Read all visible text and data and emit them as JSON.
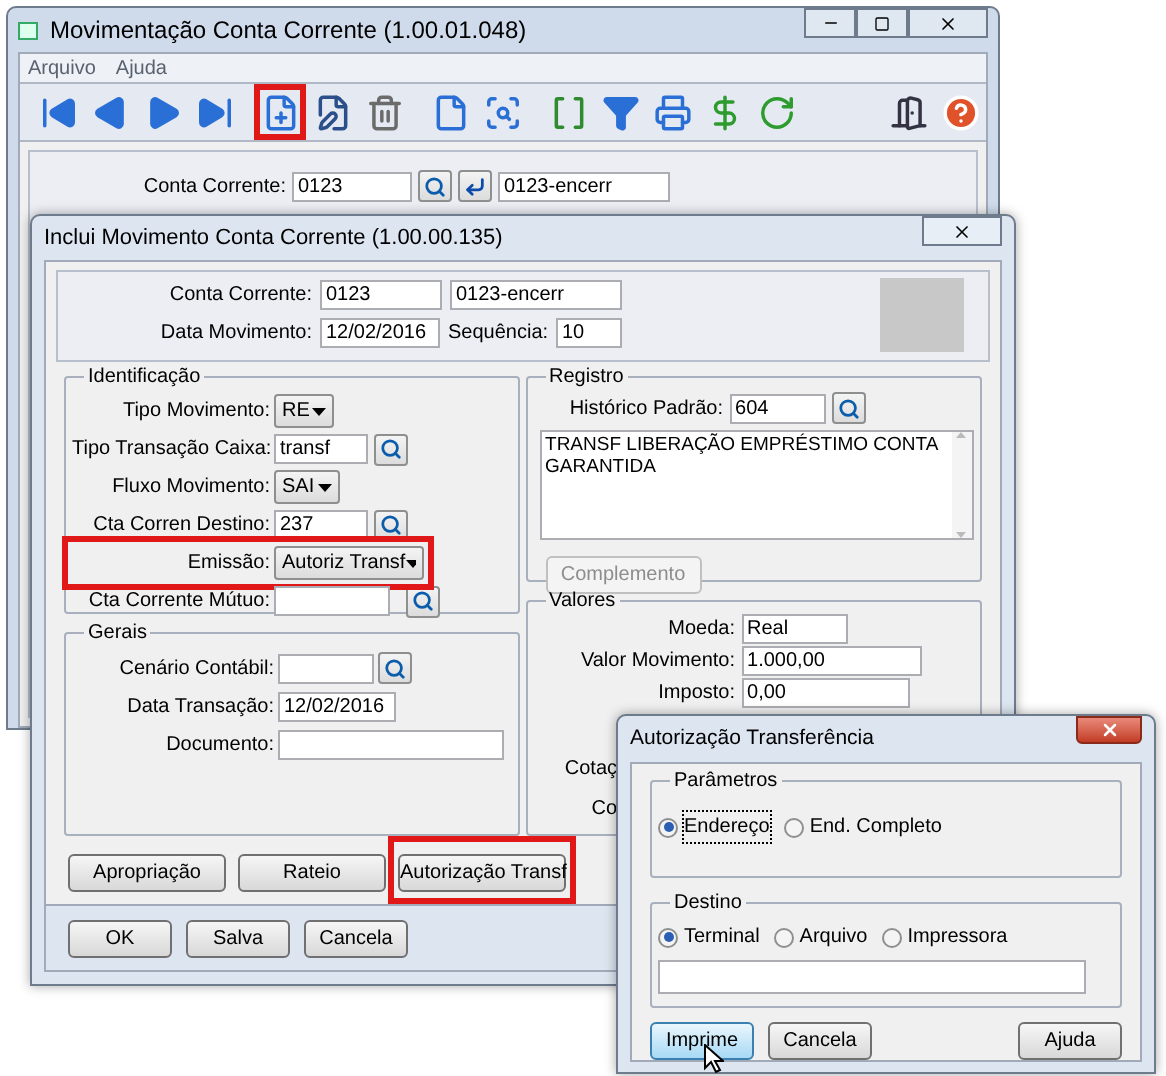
{
  "main_window": {
    "title": "Movimentação Conta Corrente (1.00.01.048)",
    "menu": [
      "Arquivo",
      "Ajuda"
    ],
    "toolbar": [
      {
        "kind": "first",
        "highlighted": false
      },
      {
        "kind": "previous",
        "highlighted": false
      },
      {
        "kind": "next",
        "highlighted": false
      },
      {
        "kind": "last",
        "highlighted": false
      },
      {
        "kind": "new",
        "highlighted": true
      },
      {
        "kind": "edit",
        "highlighted": false
      },
      {
        "kind": "delete",
        "highlighted": false
      },
      {
        "kind": "document",
        "highlighted": false
      },
      {
        "kind": "preview",
        "highlighted": false
      },
      {
        "kind": "goto",
        "highlighted": false
      },
      {
        "kind": "filter",
        "highlighted": false
      },
      {
        "kind": "print",
        "highlighted": false
      },
      {
        "kind": "money",
        "highlighted": false
      },
      {
        "kind": "refresh",
        "highlighted": false
      },
      {
        "kind": "exit",
        "highlighted": false
      },
      {
        "kind": "help",
        "highlighted": false
      }
    ],
    "conta_corrente": {
      "label": "Conta Corrente:",
      "value": "0123",
      "description": "0123-encerr"
    }
  },
  "include_dialog": {
    "title": "Inclui Movimento Conta Corrente (1.00.00.135)",
    "conta_corrente": {
      "label": "Conta Corrente:",
      "value": "0123",
      "description": "0123-encerr"
    },
    "data_movimento": {
      "label": "Data Movimento:",
      "value": "12/02/2016"
    },
    "sequencia": {
      "label": "Sequência:",
      "value": "10"
    },
    "identificacao": {
      "title": "Identificação",
      "rows": [
        {
          "kind": "dropdown",
          "label": "Tipo Movimento:",
          "value": "RE",
          "highlighted": false
        },
        {
          "kind": "lookup",
          "label": "Tipo Transação Caixa:",
          "value": "transf",
          "highlighted": false
        },
        {
          "kind": "dropdown",
          "label": "Fluxo Movimento:",
          "value": "SAI",
          "highlighted": false
        },
        {
          "kind": "lookup",
          "label": "Cta Corren Destino:",
          "value": "237",
          "highlighted": false
        },
        {
          "kind": "dropdown",
          "label": "Emissão:",
          "value": "Autoriz Transf",
          "highlighted": true
        },
        {
          "kind": "lookup",
          "label": "Cta Corrente Mútuo:",
          "value": "",
          "highlighted": false
        }
      ]
    },
    "gerais": {
      "title": "Gerais",
      "rows": [
        {
          "kind": "lookup",
          "label": "Cenário Contábil:",
          "value": ""
        },
        {
          "kind": "text",
          "label": "Data Transação:",
          "value": "12/02/2016"
        },
        {
          "kind": "text",
          "label": "Documento:",
          "value": ""
        }
      ]
    },
    "registro": {
      "title": "Registro",
      "historico": {
        "label": "Histórico Padrão:",
        "value": "604"
      },
      "text": "TRANSF LIBERAÇÃO EMPRÉSTIMO CONTA GARANTIDA",
      "complemento": {
        "label": "Complemento",
        "disabled": true
      }
    },
    "valores": {
      "title": "Valores",
      "rows": [
        {
          "kind": "text",
          "label": "Moeda:",
          "value": "Real"
        },
        {
          "kind": "text",
          "label": "Valor Movimento:",
          "value": "1.000,00"
        },
        {
          "kind": "text",
          "label": "Imposto:",
          "value": "0,00"
        },
        {
          "kind": "cut",
          "label": "Cotaç"
        },
        {
          "kind": "cut",
          "label": "Co"
        }
      ]
    },
    "action_buttons": [
      {
        "label": "Apropriação",
        "highlighted": false
      },
      {
        "label": "Rateio",
        "highlighted": false
      },
      {
        "label": "Autorização Transf",
        "highlighted": true
      }
    ],
    "footer_buttons": [
      "OK",
      "Salva",
      "Cancela"
    ]
  },
  "auth_dialog": {
    "title": "Autorização Transferência",
    "parametros": {
      "title": "Parâmetros",
      "options": [
        {
          "label": "Endereço",
          "selected": true
        },
        {
          "label": "End. Completo",
          "selected": false
        }
      ]
    },
    "destino": {
      "title": "Destino",
      "options": [
        {
          "label": "Terminal",
          "selected": true
        },
        {
          "label": "Arquivo",
          "selected": false
        },
        {
          "label": "Impressora",
          "selected": false
        }
      ]
    },
    "buttons": [
      {
        "label": "Imprime",
        "focused": true
      },
      {
        "label": "Cancela",
        "focused": false
      },
      {
        "label": "Ajuda",
        "focused": false
      }
    ]
  }
}
